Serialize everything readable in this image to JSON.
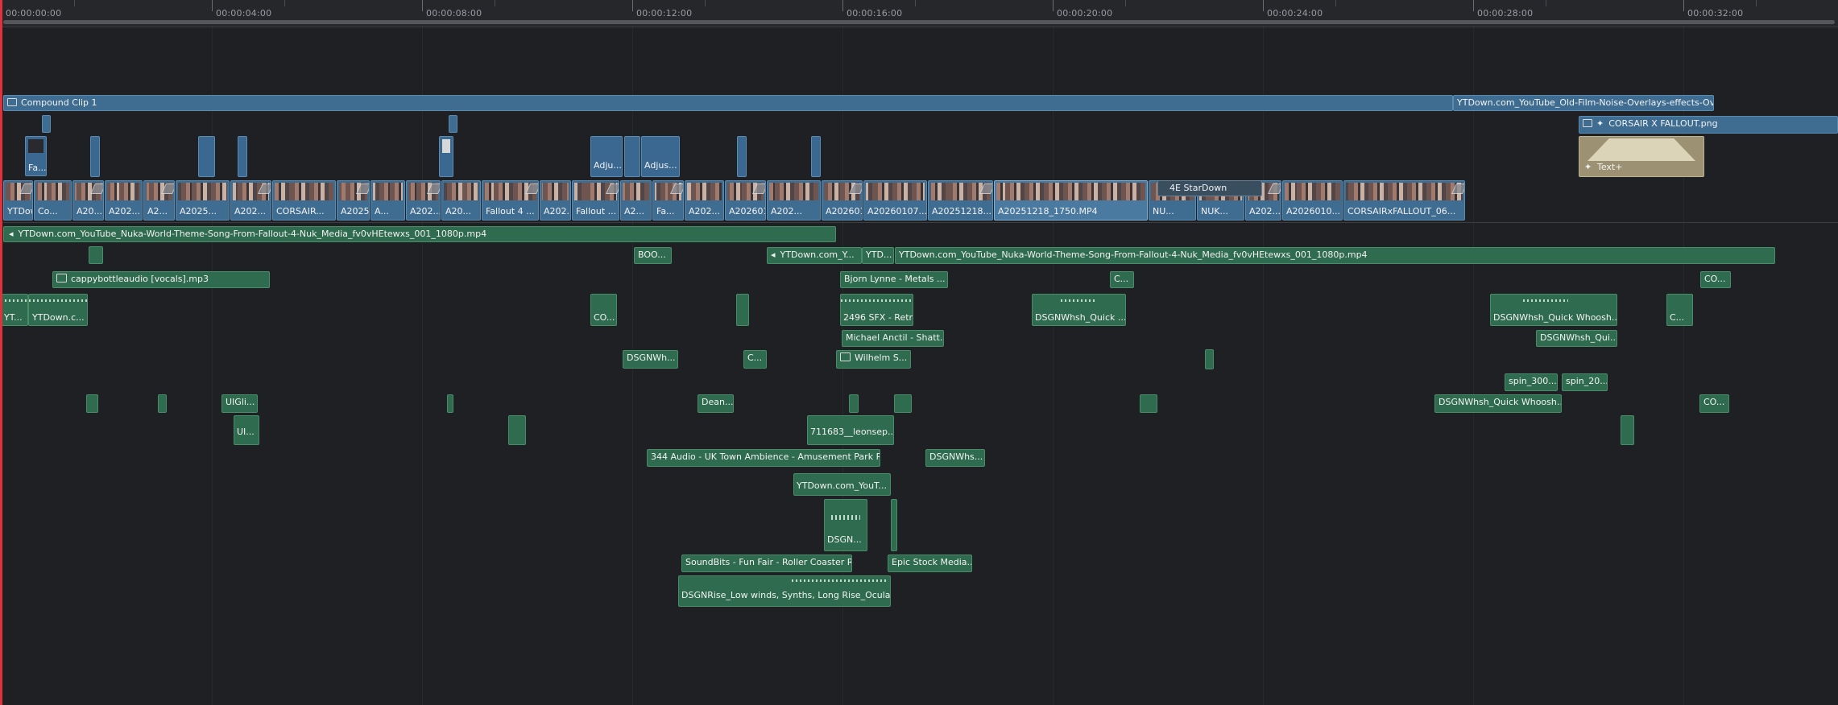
{
  "ruler": {
    "timecodes": [
      "00:00:00:00",
      "00:00:04:00",
      "00:00:08:00",
      "00:00:12:00",
      "00:00:16:00",
      "00:00:20:00",
      "00:00:24:00",
      "00:00:28:00",
      "00:00:32:00"
    ]
  },
  "video_tracks": {
    "v5_compound_label": "Compound Clip 1",
    "v5_overlay_label": "YTDown.com_YouTube_Old-Film-Noise-Overlays-effects-Ov...",
    "v4_corsair_label": "CORSAIR X FALLOUT.png",
    "v3_fallout_label": "Fa...",
    "v3_adj1_label": "Adju...",
    "v3_adj2_label": "Adjus...",
    "v3_text_label": "Text+",
    "v1_clips": [
      "YTDow...",
      "Co...",
      "A20...",
      "A202...",
      "A2...",
      "A2025...",
      "A202...",
      "CORSAIR...",
      "A2025...",
      "A...",
      "A202...",
      "A20...",
      "Fallout 4 ...",
      "A202...",
      "Fallout ...",
      "A2...",
      "Fa...",
      "A202...",
      "A202601...",
      "A202...",
      "A202601...",
      "A20260107...",
      "A20251218...",
      "A20251218_1750.MP4",
      "NU...",
      "NUK...",
      "A202...",
      "A2026010...",
      "CORSAIRxFALLOUT_06..."
    ],
    "v1_title_overlay": "4E StarDown"
  },
  "audio_tracks": {
    "a1_label": "YTDown.com_YouTube_Nuka-World-Theme-Song-From-Fallout-4-Nuk_Media_fv0vHEtewxs_001_1080p.mp4",
    "a2_boo": "BOO...",
    "a2_ytdown_short": "YTDown.com_Y...",
    "a2_ytd": "YTD...",
    "a2_long": "YTDown.com_YouTube_Nuka-World-Theme-Song-From-Fallout-4-Nuk_Media_fv0vHEtewxs_001_1080p.mp4",
    "a3_cappy": "cappybottleaudio [vocals].mp3",
    "a3_bjorn": "Bjorn Lynne - Metals ...",
    "a3_c": "C...",
    "a3_co": "CO...",
    "a4_yt": "YT...",
    "a4_ytdown": "YTDown.c...",
    "a4_co": "CO...",
    "a4_2496": "2496 SFX - Retr...",
    "a4_dsgn_quick": "DSGNWhsh_Quick ...",
    "a4_dsgn_quick_whoosh": "DSGNWhsh_Quick Whoosh...",
    "a4_c": "C...",
    "a5_michael": "Michael Anctil - Shatt...",
    "a5_dsgn_qui": "DSGNWhsh_Qui...",
    "a6_dsgnwh": "DSGNWh...",
    "a6_c": "C...",
    "a6_wilhelm": "Wilhelm S...",
    "a7_spin300": "spin_300...",
    "a7_spin20": "spin_20...",
    "a8_uigli": "UIGli...",
    "a8_dean": "Dean...",
    "a8_dsgn_quick_whoosh": "DSGNWhsh_Quick Whoosh...",
    "a8_co": "CO...",
    "a9_ui": "UI...",
    "a9_leonsep": "711683__leonsep...",
    "a10_344": "344 Audio - UK Town Ambience - Amusement Park R...",
    "a10_dsgnwhs": "DSGNWhs...",
    "a11_ytdown": "YTDown.com_YouT...",
    "a12_dsgn": "DSGN...",
    "a13_soundbits": "SoundBits - Fun Fair - Roller Coaster R...",
    "a13_epic": "Epic Stock Media...",
    "a14_dsgnrise": "DSGNRise_Low winds, Synths, Long Rise_Ocular ..."
  }
}
